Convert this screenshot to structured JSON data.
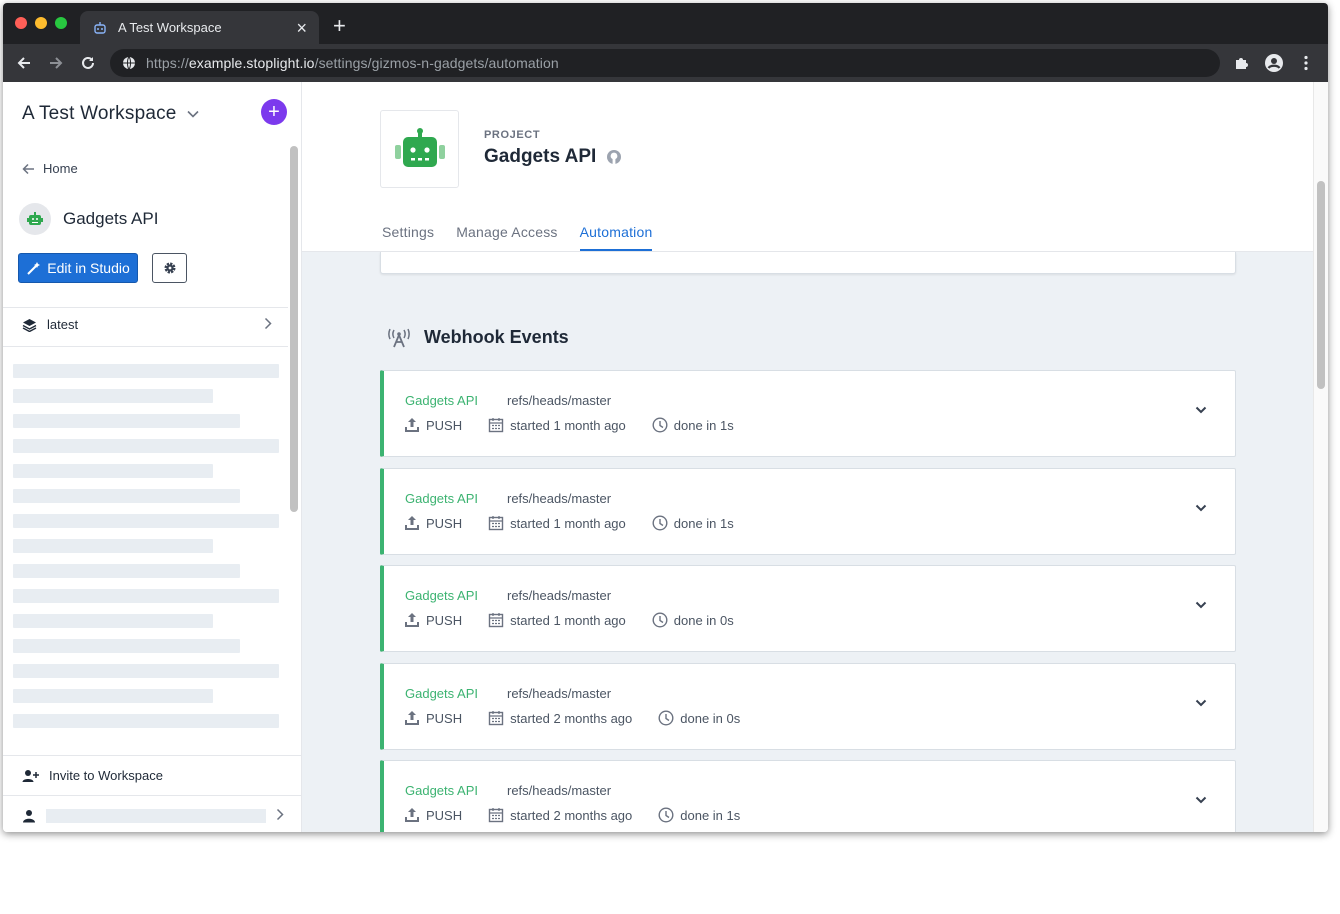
{
  "browser": {
    "tab_title": "A Test Workspace",
    "url_scheme": "https://",
    "url_host": "example.stoplight.io",
    "url_path": "/settings/gizmos-n-gadgets/automation"
  },
  "sidebar": {
    "workspace_name": "A Test Workspace",
    "home_label": "Home",
    "project_name": "Gadgets API",
    "edit_button_label": "Edit in Studio",
    "branch_label": "latest",
    "invite_label": "Invite to Workspace"
  },
  "header": {
    "kicker": "PROJECT",
    "project_title": "Gadgets API",
    "tabs": [
      {
        "label": "Settings",
        "active": false
      },
      {
        "label": "Manage Access",
        "active": false
      },
      {
        "label": "Automation",
        "active": true
      }
    ]
  },
  "webhooks": {
    "title": "Webhook Events",
    "events": [
      {
        "project": "Gadgets API",
        "ref": "refs/heads/master",
        "type": "PUSH",
        "started": "started 1 month ago",
        "duration": "done in 1s"
      },
      {
        "project": "Gadgets API",
        "ref": "refs/heads/master",
        "type": "PUSH",
        "started": "started 1 month ago",
        "duration": "done in 1s"
      },
      {
        "project": "Gadgets API",
        "ref": "refs/heads/master",
        "type": "PUSH",
        "started": "started 1 month ago",
        "duration": "done in 0s"
      },
      {
        "project": "Gadgets API",
        "ref": "refs/heads/master",
        "type": "PUSH",
        "started": "started 2 months ago",
        "duration": "done in 0s"
      },
      {
        "project": "Gadgets API",
        "ref": "refs/heads/master",
        "type": "PUSH",
        "started": "started 2 months ago",
        "duration": "done in 1s"
      }
    ]
  },
  "colors": {
    "accent_blue": "#1d6fd6",
    "success_green": "#3cb371",
    "plus_purple": "#7c3aed"
  }
}
